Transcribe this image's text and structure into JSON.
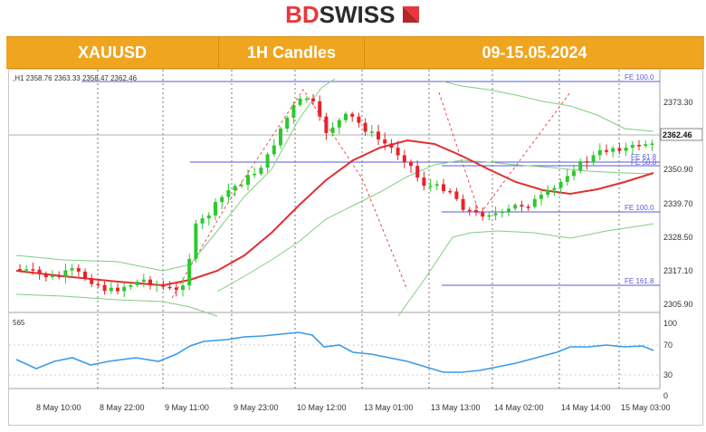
{
  "brand": {
    "name_part1": "BD",
    "name_part2": "SWISS"
  },
  "header": {
    "symbol": "XAUUSD",
    "timeframe": "1H Candles",
    "date_range": "09-15.05.2024"
  },
  "chart": {
    "info_line": ",H1  2358.76 2363.33 2358.47 2362.46",
    "indicator_label": "565",
    "price_labels": [
      "2373.30",
      "2362.46",
      "2350.90",
      "2339.70",
      "2328.50",
      "2317.10",
      "2305.90"
    ],
    "current_price": "2362.46",
    "fib_labels": {
      "top": "FE 100.0",
      "mid1": "FE 61.8",
      "mid2": "FE 50.0",
      "fe100": "FE 100.0",
      "fe161": "FE 161.8"
    },
    "rsi_scale": [
      "100",
      "70",
      "30",
      "0"
    ],
    "time_labels": [
      "8 May 10:00",
      "8 May 22:00",
      "9 May 11:00",
      "9 May 23:00",
      "10 May 12:00",
      "13 May 01:00",
      "13 May 13:00",
      "14 May 02:00",
      "14 May 14:00",
      "15 May 03:00"
    ],
    "colors": {
      "up": "#2ec82e",
      "down": "#e8222a",
      "ma": "#e03030",
      "band": "#7fcf7f",
      "rsi": "#3a9ae8",
      "fib": "#5a5ad8"
    }
  }
}
